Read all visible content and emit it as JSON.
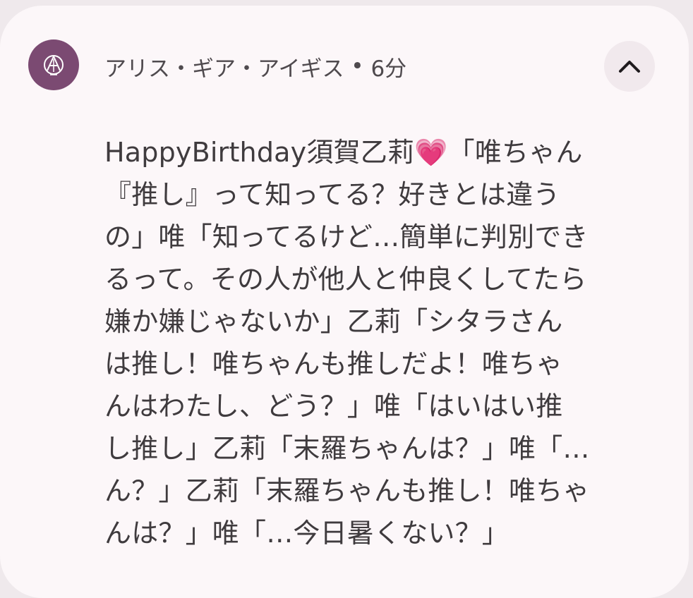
{
  "notification": {
    "app_name": "アリス・ギア・アイギス",
    "separator": " • ",
    "time": "6分",
    "app_icon": "alice-gear-aegis-logo-icon",
    "collapse_icon": "chevron-up-icon",
    "message": "HappyBirthday須賀乙莉💗「唯ちゃん\n『推し』って知ってる？好きとは違う\nの」唯「知ってるけど…簡単に判別でき\nるって。その人が他人と仲良くしてたら\n嫌か嫌じゃないか」乙莉「シタラさん\nは推し！唯ちゃんも推しだよ！唯ちゃ\nんはわたし、どう？」唯「はいはい推\nし推し」乙莉「末羅ちゃんは？」唯「…\nん？」乙莉「末羅ちゃんも推し！唯ちゃ\nんは？」唯「…今日暑くない？」"
  },
  "colors": {
    "card_background": "#fcf7f9",
    "icon_background": "#7b4a72",
    "text": "#3f3b3e"
  }
}
